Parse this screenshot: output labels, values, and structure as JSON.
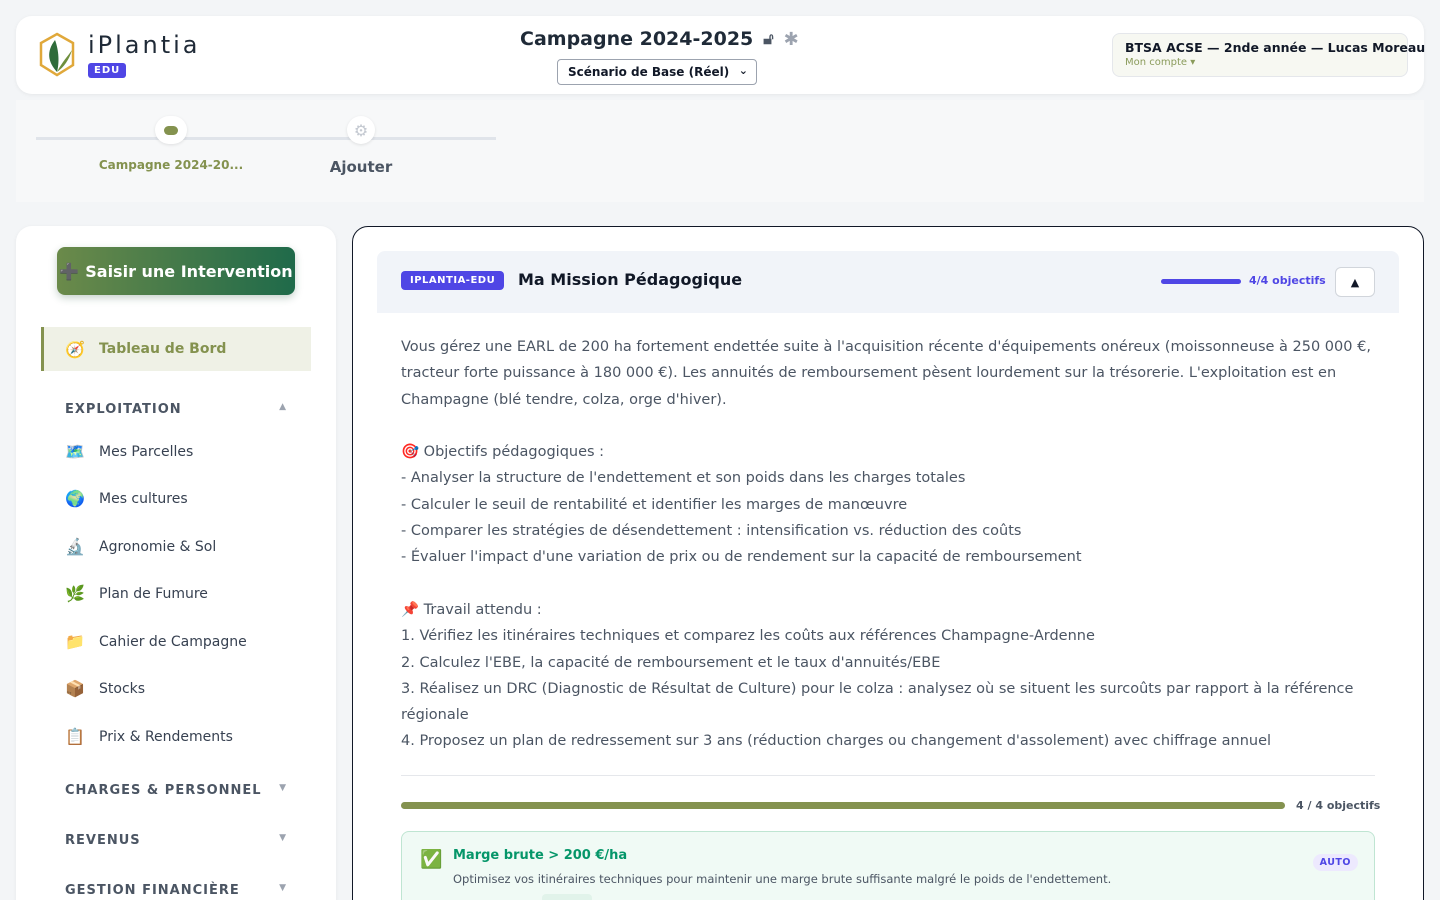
{
  "header": {
    "logo_name": "iPlantia",
    "logo_badge": "EDU",
    "campaign_title": "Campagne 2024-2025",
    "scenario_selected": "Scénario de Base (Réel)",
    "account_name": "BTSA ACSE — 2nde année — Lucas Moreau",
    "account_link": "Mon compte ▾"
  },
  "tabs": [
    {
      "label": "Campagne 2024-20..."
    },
    {
      "label": "Ajouter"
    }
  ],
  "sidebar": {
    "cta": "Saisir une Intervention",
    "active": {
      "icon": "🧭",
      "label": "Tableau de Bord"
    },
    "sections": [
      {
        "label": "EXPLOITATION",
        "chevron": "▲"
      },
      {
        "label": "CHARGES & PERSONNEL",
        "chevron": "▼"
      },
      {
        "label": "REVENUS",
        "chevron": "▼"
      },
      {
        "label": "GESTION FINANCIÈRE",
        "chevron": "▼"
      }
    ],
    "items": [
      {
        "icon": "🗺️",
        "label": "Mes Parcelles"
      },
      {
        "icon": "🌍",
        "label": "Mes cultures"
      },
      {
        "icon": "🔬",
        "label": "Agronomie & Sol"
      },
      {
        "icon": "🌿",
        "label": "Plan de Fumure"
      },
      {
        "icon": "📁",
        "label": "Cahier de Campagne"
      },
      {
        "icon": "📦",
        "label": "Stocks"
      },
      {
        "icon": "📋",
        "label": "Prix & Rendements"
      }
    ]
  },
  "mission": {
    "badge": "IPLANTIA-EDU",
    "title": "Ma Mission Pédagogique",
    "count_label": "4/4 objectifs",
    "progress": 1.0,
    "toggle": "▲",
    "lines": [
      "Vous gérez une EARL de 200 ha fortement endettée suite à l'acquisition récente d'équipements onéreux (moissonneuse à 250 000 €,",
      "tracteur forte puissance à 180 000 €). Les annuités de remboursement pèsent lourdement sur la trésorerie. L'exploitation est en",
      "Champagne (blé tendre, colza, orge d'hiver).",
      "",
      "🎯 Objectifs pédagogiques :",
      "- Analyser la structure de l'endettement et son poids dans les charges totales",
      "- Calculer le seuil de rentabilité et identifier les marges de manœuvre",
      "- Comparer les stratégies de désendettement : intensification vs. réduction des coûts",
      "- Évaluer l'impact d'une variation de prix ou de rendement sur la capacité de remboursement",
      "",
      "📌 Travail attendu :",
      "1. Vérifiez les itinéraires techniques et comparez les coûts aux références Champagne-Ardenne",
      "2. Calculez l'EBE, la capacité de remboursement et le taux d'annuités/EBE",
      "3. Réalisez un DRC (Diagnostic de Résultat de Culture) pour le colza : analysez où se situent les surcoûts par rapport à la référence",
      "régionale",
      "4. Proposez un plan de redressement sur 3 ans (réduction charges ou changement d'assolement) avec chiffrage annuel"
    ],
    "objectives_label": "4 / 4 objectifs",
    "objectives_progress": 1.0,
    "objective": {
      "title": "Marge brute > 200 €/ha",
      "description": "Optimisez vos itinéraires techniques pour maintenir une marge brute suffisante malgré le poids de l'endettement.",
      "tag": "AUTO"
    }
  }
}
